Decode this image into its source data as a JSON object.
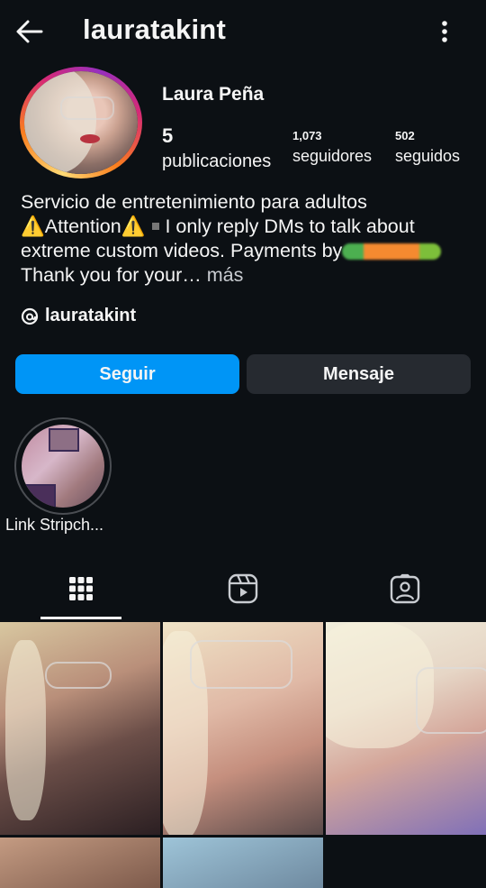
{
  "header": {
    "username": "lauratakint",
    "back_icon": "arrow-left-icon",
    "menu_icon": "kebab-menu-icon"
  },
  "profile": {
    "full_name": "Laura Peña",
    "stats": {
      "posts": {
        "value": "5",
        "label": "publicaciones"
      },
      "followers": {
        "value": "1,073",
        "label": "seguidores"
      },
      "following": {
        "value": "502",
        "label": "seguidos"
      }
    },
    "bio": {
      "line1": "Servicio de entretenimiento para adultos",
      "line2_warn_left": "⚠️",
      "line2_word": "Attention",
      "line2_warn_right": "⚠️",
      "line2_rest": "I only reply DMs to talk about",
      "line3": "extreme custom videos. Payments by",
      "line4": "Thank you for your… ",
      "more": "más"
    },
    "threads_handle": "lauratakint"
  },
  "actions": {
    "follow": "Seguir",
    "message": "Mensaje"
  },
  "highlights": [
    {
      "label": "Link Stripch..."
    }
  ],
  "tabs": {
    "active": "grid",
    "items": [
      "posts-grid",
      "reels",
      "tagged"
    ]
  },
  "colors": {
    "background": "#0c1014",
    "primary": "#0095f6",
    "secondary_button": "#262a30",
    "text": "#f5f5f5"
  }
}
